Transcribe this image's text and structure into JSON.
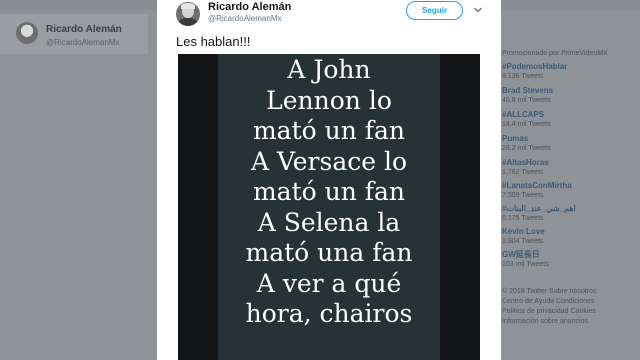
{
  "background": {
    "profile_name": "Ricardo Alemán",
    "profile_handle": "@RicardoAlemanMx",
    "promo": "Promocionado por PrimeVideoMX",
    "trends": [
      {
        "title": "#PodemosHablar",
        "count": "8.136 Tweets"
      },
      {
        "title": "Brad Stevens",
        "count": "40,8 mil Tweets"
      },
      {
        "title": "#ALLCAPS",
        "count": "14,4 mil Tweets"
      },
      {
        "title": "Pumas",
        "count": "28,2 mil Tweets"
      },
      {
        "title": "#AltasHoras",
        "count": "1.762 Tweets"
      },
      {
        "title": "#LanataConMirtha",
        "count": "7.509 Tweets"
      },
      {
        "title": "#اهم_شي_عند_البنات",
        "count": "6.175 Tweets"
      },
      {
        "title": "Kevin Love",
        "count": "3.904 Tweets"
      },
      {
        "title": "GW延長日",
        "count": "103 mil Tweets"
      }
    ],
    "footer": [
      "© 2018 Twitter   Sobre nosotros",
      "Centro de Ayuda   Condiciones",
      "Política de privacidad   Cookies",
      "Información sobre anuncios"
    ]
  },
  "tweet": {
    "author_name": "Ricardo Alemán",
    "author_handle": "@RicardoAlemanMx",
    "follow_label": "Seguir",
    "text": "Les hablan!!!",
    "image_lines": [
      "A John",
      "Lennon lo",
      "mató un fan",
      "A Versace lo",
      "mató un fan",
      "A Selena la",
      "mató una fan",
      "A ver a qué",
      "hora, chairos"
    ]
  },
  "icons": {
    "menu": "chevron-down-icon",
    "avatar": "profile-photo"
  },
  "colors": {
    "accent": "#1da1f2",
    "overlay": "#8f9398",
    "image_bg": "#263236"
  }
}
